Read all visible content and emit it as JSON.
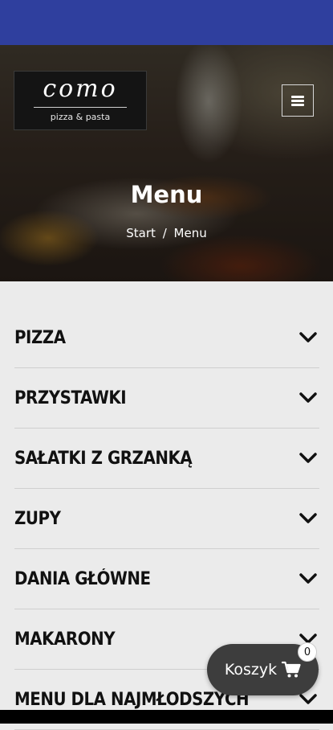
{
  "header": {
    "logo_name": "como",
    "logo_tagline": "pizza & pasta"
  },
  "hero": {
    "title": "Menu",
    "breadcrumb": {
      "home": "Start",
      "separator": "/",
      "current": "Menu"
    }
  },
  "menu_categories": [
    {
      "label": "PIZZA"
    },
    {
      "label": "PRZYSTAWKI"
    },
    {
      "label": "SAŁATKI Z GRZANKĄ"
    },
    {
      "label": "ZUPY"
    },
    {
      "label": "DANIA GŁÓWNE"
    },
    {
      "label": "MAKARONY"
    },
    {
      "label": "MENU DLA NAJMŁODSZYCH"
    }
  ],
  "cart": {
    "label": "Koszyk",
    "count": "0"
  },
  "colors": {
    "status_bar": "#2f3f9e",
    "page_bg": "#ebebeb",
    "cart_bg": "#3d3d3d"
  },
  "icons": {
    "menu": "hamburger-icon",
    "expand": "chevron-down-icon",
    "cart": "shopping-cart-icon"
  }
}
